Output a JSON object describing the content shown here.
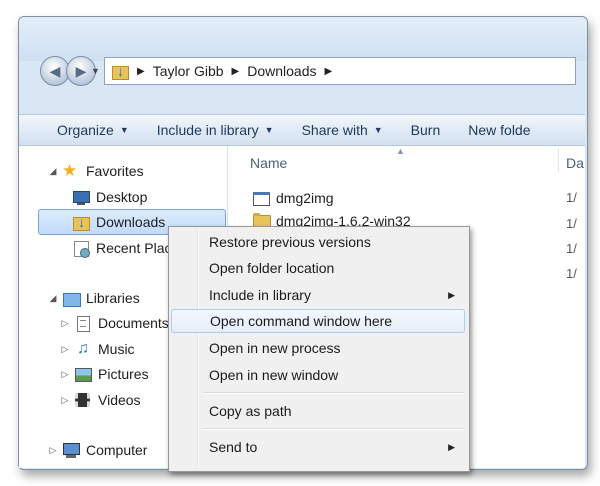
{
  "address": {
    "segments": [
      "Taylor Gibb",
      "Downloads"
    ]
  },
  "toolbar": [
    {
      "label": "Organize",
      "caret": true
    },
    {
      "label": "Include in library",
      "caret": true
    },
    {
      "label": "Share with",
      "caret": true
    },
    {
      "label": "Burn",
      "caret": false
    },
    {
      "label": "New folde",
      "caret": false
    }
  ],
  "nav": {
    "favorites": "Favorites",
    "desktop": "Desktop",
    "downloads": "Downloads",
    "recent": "Recent Plac",
    "libraries": "Libraries",
    "documents": "Documents",
    "music": "Music",
    "pictures": "Pictures",
    "videos": "Videos",
    "computer": "Computer"
  },
  "columns": {
    "name": "Name",
    "date": "Da"
  },
  "files": [
    {
      "name": "dmg2img",
      "date": "1/"
    },
    {
      "name": "dmg2img-1.6.2-win32",
      "date": "1/"
    },
    {
      "name": "",
      "date": "1/"
    },
    {
      "name": "",
      "date": "1/"
    }
  ],
  "context_menu": {
    "items": [
      {
        "label": "Restore previous versions"
      },
      {
        "label": "Open folder location"
      },
      {
        "label": "Include in library",
        "submenu": true
      },
      {
        "label": "Open command window here",
        "highlighted": true
      },
      {
        "label": "Open in new process"
      },
      {
        "label": "Open in new window"
      },
      {
        "label": "Copy as path"
      },
      {
        "label": "Send to",
        "submenu": true
      }
    ]
  }
}
